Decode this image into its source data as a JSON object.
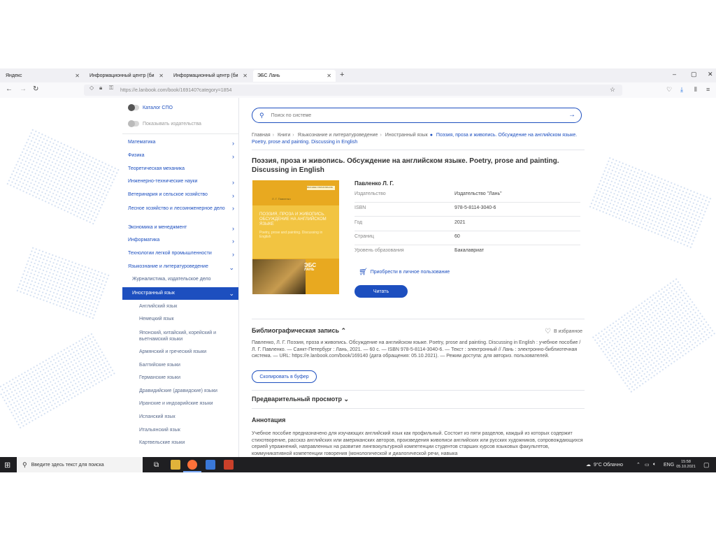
{
  "browser": {
    "tabs": [
      {
        "label": "Яндекс",
        "color": "#e53935"
      },
      {
        "label": "Информационный центр (би",
        "color": "#1e66d0"
      },
      {
        "label": "Информационный центр (би",
        "color": "#e9a227"
      },
      {
        "label": "ЭБС Лань",
        "color": "#1d4fbf"
      }
    ],
    "tab_close": "✕",
    "new_tab": "+",
    "url": "https://e.lanbook.com/book/169140?category=1854",
    "window_controls": [
      "–",
      "▢",
      "✕"
    ]
  },
  "sidebar": {
    "toggles": [
      {
        "label": "Каталог СПО"
      },
      {
        "label": "Показывать издательства"
      }
    ],
    "items": [
      {
        "label": "Математика",
        "chevron": "›"
      },
      {
        "label": "Физика",
        "chevron": "›"
      },
      {
        "label": "Теоретическая механика",
        "chevron": ""
      },
      {
        "label": "Инженерно-технические науки",
        "chevron": "›"
      },
      {
        "label": "Ветеринария и сельское хозяйство",
        "chevron": "›"
      },
      {
        "label": "Лесное хозяйство и лесоинженерное дело",
        "chevron": "›"
      },
      {
        "label": "Экономика и менеджмент",
        "chevron": "›"
      },
      {
        "label": "Информатика",
        "chevron": "›"
      },
      {
        "label": "Технологии легкой промышленности",
        "chevron": "›"
      },
      {
        "label": "Языкознание и литературоведение",
        "chevron": "⌄"
      }
    ],
    "sub_items": [
      {
        "label": "Журналистика, издательское дело"
      }
    ],
    "active_item": {
      "label": "Иностранный язык",
      "chevron": "⌄"
    },
    "languages": [
      "Английский язык",
      "Немецкий язык",
      "Японский, китайский, корейский и вьетнамский языки",
      "Армянский и греческий языки",
      "Балтийские языки",
      "Германские языки",
      "Дравидийские (дравидские) языки",
      "Иранские и индоарийские языки",
      "Испанский язык",
      "Итальянский язык",
      "Картвельские языки"
    ]
  },
  "main": {
    "search_placeholder": "Поиск по системе",
    "breadcrumbs": [
      "Главная",
      "Книги",
      "Языкознание и литературоведение",
      "Иностранный язык"
    ],
    "breadcrumb_current": "Поэзия, проза и живопись. Обсуждение на английском языке. Poetry, prose and painting. Discussing in English",
    "title": "Поэзия, проза и живопись. Обсуждение на английском языке. Poetry, prose and painting. Discussing in English",
    "author": "Павленко Л. Г.",
    "meta": [
      {
        "key": "Издательство",
        "value": "Издательство \"Лань\""
      },
      {
        "key": "ISBN",
        "value": "978-5-8114-3040-6"
      },
      {
        "key": "Год",
        "value": "2021"
      },
      {
        "key": "Страниц",
        "value": "60"
      },
      {
        "key": "Уровень образования",
        "value": "Бакалавриат"
      }
    ],
    "buy_label": "Приобрести в личное пользование",
    "read_label": "Читать",
    "bib_title": "Библиографическая запись ⌃",
    "favorites_label": "В избранное",
    "bib_text": "Павленко, Л. Г. Поэзия, проза и живопись. Обсуждение на английском языке. Poetry, prose and painting. Discussing in English : учебное пособие / Л. Г. Павленко. — Санкт-Петербург : Лань, 2021. — 60 с. — ISBN 978-5-8114-3040-6. — Текст : электронный // Лань : электронно-библиотечная система. — URL: https://e.lanbook.com/book/169140 (дата обращения: 05.10.2021). — Режим доступа: для авториз. пользователей.",
    "copy_label": "Скопировать в буфер",
    "preview_title": "Предварительный просмотр ⌄",
    "annotation_title": "Аннотация",
    "annotation_text": "Учебное пособие предназначено для изучающих английский язык как профильный. Состоит из пяти разделов, каждый из которых содержит стихотворение, рассказ английских или американских авторов, произведения живописи английских или русских художников, сопровождающихся серией упражнений, направленных на развитие лингвокультурной компетенции студентов старших курсов языковых факультетов, коммуникативной компетенции говорения (монологической и диалогической речи, навыка",
    "cover": {
      "label": "ВЫСШЕЕ ОБРАЗОВАНИЕ",
      "author": "Л. Г. Павленко",
      "title": "Поэзия, проза и живопись. Обсуждение на английском языке",
      "subtitle": "Poetry, prose and painting. Discussing in English",
      "ebs": "ЭБС",
      "ebs_sub": "ЛАНЬ"
    }
  },
  "taskbar": {
    "search_placeholder": "Введите здесь текст для поиска",
    "weather": "9°C  Облачно",
    "lang": "ENG",
    "time": "15:58",
    "date": "05.10.2021"
  }
}
